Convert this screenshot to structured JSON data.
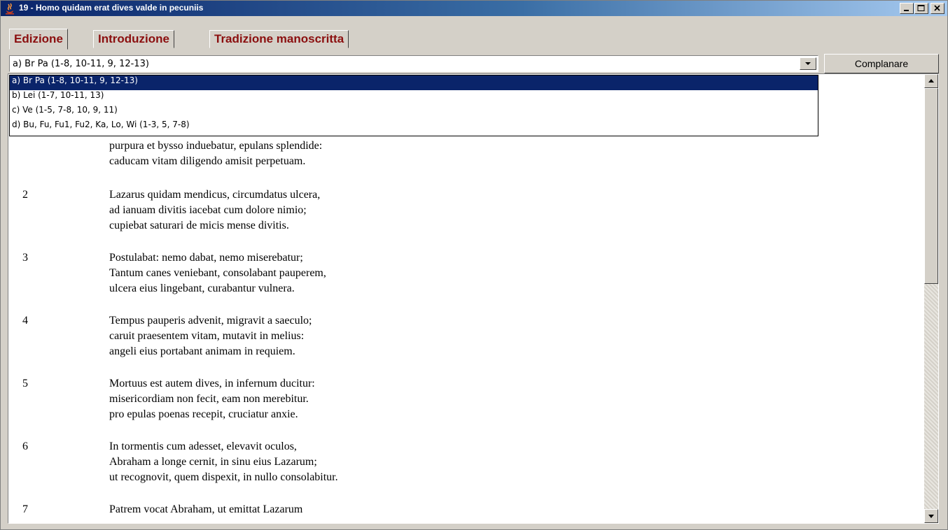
{
  "window": {
    "title": "19 - Homo quidam erat dives valde in pecuniis",
    "controls": {
      "minimize_icon": "minimize-icon",
      "maximize_icon": "maximize-icon",
      "close_icon": "close-icon"
    }
  },
  "tabs": [
    {
      "label": "Edizione",
      "active": true
    },
    {
      "label": "Introduzione",
      "active": false
    },
    {
      "label": "Tradizione manoscritta",
      "active": false
    }
  ],
  "version_select": {
    "value": "a) Br Pa (1-8, 10-11, 9, 12-13)",
    "options": [
      "a) Br Pa (1-8, 10-11, 9, 12-13)",
      "b) Lei (1-7, 10-11, 13)",
      "c) Ve (1-5, 7-8, 10, 9, 11)",
      "d) Bu, Fu, Fu1, Fu2, Ka, Lo, Wi (1-3, 5, 7-8)"
    ],
    "selected_index": 0
  },
  "complanare_button": "Complanare",
  "stanzas": [
    {
      "num": "",
      "lines": [
        "purpura et bysso induebatur, epulans splendide:",
        "caducam vitam diligendo amisit perpetuam."
      ]
    },
    {
      "num": "2",
      "lines": [
        "Lazarus quidam mendicus, circumdatus ulcera,",
        "ad ianuam divitis iacebat cum dolore nimio;",
        "cupiebat saturari de micis mense divitis."
      ]
    },
    {
      "num": "3",
      "lines": [
        "Postulabat: nemo dabat, nemo miserebatur;",
        "Tantum canes veniebant, consolabant pauperem,",
        "ulcera eius lingebant, curabantur vulnera."
      ]
    },
    {
      "num": "4",
      "lines": [
        "Tempus pauperis advenit, migravit a saeculo;",
        "caruit praesentem vitam, mutavit in melius:",
        "angeli eius portabant animam in requiem."
      ]
    },
    {
      "num": "5",
      "lines": [
        "Mortuus est autem dives, in infernum ducitur:",
        "misericordiam non fecit, eam non merebitur.",
        "pro epulas poenas recepit, cruciatur anxie."
      ]
    },
    {
      "num": "6",
      "lines": [
        "In tormentis cum adesset, elevavit oculos,",
        "Abraham a longe cernit, in sinu eius Lazarum;",
        "ut recognovit, quem dispexit, in nullo consolabitur."
      ]
    },
    {
      "num": "7",
      "lines": [
        "Patrem vocat Abraham, ut emittat Lazarum"
      ]
    }
  ],
  "colors": {
    "title_bar_start": "#0a246a",
    "title_bar_end": "#a6caf0",
    "tab_text": "#8b0f0f",
    "selection": "#0a246a",
    "chrome": "#d4d0c8"
  }
}
